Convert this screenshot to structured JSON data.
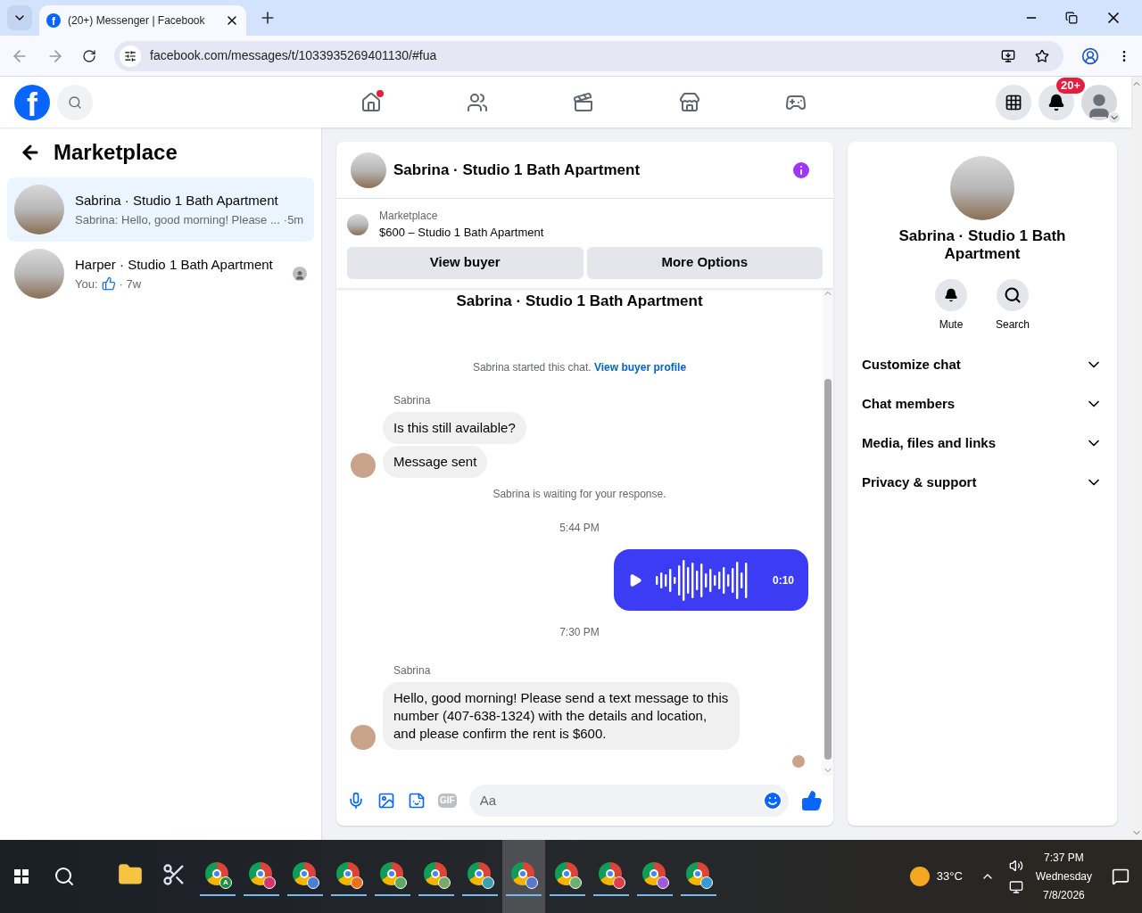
{
  "browser": {
    "favicon_letter": "f",
    "tab_title": "(20+) Messenger | Facebook",
    "url": "facebook.com/messages/t/1033935269401130/#fua"
  },
  "fb_nav": {
    "logo_letter": "f",
    "items": [
      {
        "kind": "home",
        "dot": true
      },
      {
        "kind": "friends",
        "dot": false
      },
      {
        "kind": "video",
        "dot": false
      },
      {
        "kind": "marketplace",
        "dot": false
      },
      {
        "kind": "gaming",
        "dot": false
      }
    ],
    "notification_badge": "20+"
  },
  "sidebar": {
    "title": "Marketplace",
    "conversations": [
      {
        "name": "Sabrina · Studio 1 Bath Apartment",
        "preview": "Sabrina: Hello, good morning! Please ...",
        "like": false,
        "time": "·5m",
        "selected": true,
        "seen": false
      },
      {
        "name": "Harper · Studio 1 Bath Apartment",
        "preview": "You:",
        "like": true,
        "time": "· 7w",
        "selected": false,
        "seen": true
      }
    ]
  },
  "chat": {
    "title": "Sabrina · Studio 1 Bath Apartment",
    "listing": {
      "label": "Marketplace",
      "title": "$600 – Studio 1 Bath Apartment"
    },
    "buttons": [
      "View buyer",
      "More Options"
    ],
    "messages": [
      {
        "kind": "heading",
        "text": "Sabrina · Studio 1 Bath Apartment"
      },
      {
        "kind": "system",
        "text": "Sabrina started this chat.",
        "link": "View buyer profile"
      },
      {
        "kind": "sender",
        "text": "Sabrina"
      },
      {
        "kind": "incoming",
        "text": "Is this still available?",
        "avatar": false
      },
      {
        "kind": "incoming",
        "text": "Message sent",
        "avatar": true
      },
      {
        "kind": "system",
        "text": "Sabrina is waiting for your response."
      },
      {
        "kind": "time",
        "text": "5:44 PM"
      },
      {
        "kind": "audio",
        "text": "0:10"
      },
      {
        "kind": "time",
        "text": "7:30 PM"
      },
      {
        "kind": "sender",
        "text": "Sabrina"
      },
      {
        "kind": "incoming",
        "text": "Hello, good morning! Please send a text message to this number (407-638-1324) with the details and location, and please confirm the rent is $600.",
        "avatar": true
      }
    ],
    "composer": {
      "placeholder": "Aa",
      "gif_label": "GIF"
    }
  },
  "info": {
    "name": "Sabrina · Studio 1 Bath Apartment",
    "actions": [
      {
        "kind": "bell",
        "label": "Mute"
      },
      {
        "kind": "search",
        "label": "Search"
      }
    ],
    "sections": [
      {
        "label": "Customize chat",
        "expanded": false
      },
      {
        "label": "Chat members",
        "expanded": false
      },
      {
        "label": "Media, files and links",
        "expanded": false
      },
      {
        "label": "Privacy & support",
        "expanded": false
      }
    ]
  },
  "taskbar": {
    "apps": [
      {
        "kind": "folder",
        "selected": false
      },
      {
        "kind": "tool",
        "selected": false
      },
      {
        "kind": "chrome",
        "color": "#1e8e3e",
        "letter": "A",
        "selected": false
      },
      {
        "kind": "chrome",
        "color": "#d6336c",
        "selected": false
      },
      {
        "kind": "chrome",
        "color": "#4a7fd4",
        "selected": false
      },
      {
        "kind": "chrome",
        "color": "#e8711c",
        "selected": false
      },
      {
        "kind": "chrome",
        "color": "#5fa860",
        "selected": false
      },
      {
        "kind": "chrome",
        "color": "#7aa86a",
        "selected": false
      },
      {
        "kind": "chrome",
        "color": "#3ca0b0",
        "selected": false
      },
      {
        "kind": "chrome",
        "color": "#5a78d0",
        "selected": true
      },
      {
        "kind": "chrome",
        "color": "#6bb070",
        "selected": false
      },
      {
        "kind": "chrome",
        "color": "#e03c4c",
        "selected": false
      },
      {
        "kind": "chrome",
        "color": "#a05bd8",
        "selected": false
      },
      {
        "kind": "chrome",
        "color": "#3a9ad0",
        "selected": false
      }
    ],
    "temperature": "33°C",
    "time": "7:37 PM",
    "day": "Wednesday",
    "date": "7/8/2026"
  }
}
